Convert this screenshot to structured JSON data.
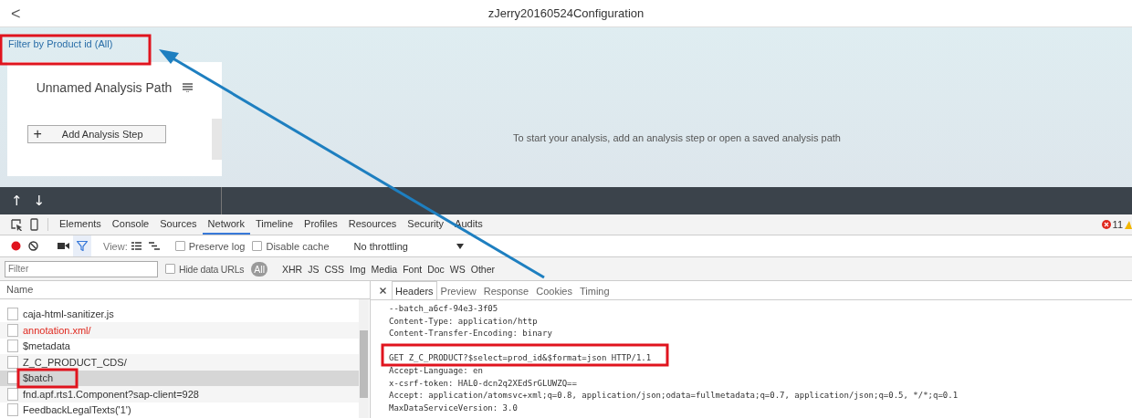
{
  "header": {
    "back": "<",
    "title": "zJerry20160524Configuration"
  },
  "filter_link": "Filter by Product id (All)",
  "analysis_path": {
    "title": "Unnamed Analysis Path",
    "add_button": {
      "icon": "+",
      "label": "Add Analysis Step"
    }
  },
  "empty_message": "To start your analysis, add an analysis step or open a saved analysis path",
  "nav_buttons": [
    "↑",
    "↓"
  ],
  "devtools": {
    "tabs": [
      {
        "label": "Elements",
        "selected": false
      },
      {
        "label": "Console",
        "selected": false
      },
      {
        "label": "Sources",
        "selected": false
      },
      {
        "label": "Network",
        "selected": true
      },
      {
        "label": "Timeline",
        "selected": false
      },
      {
        "label": "Profiles",
        "selected": false
      },
      {
        "label": "Resources",
        "selected": false
      },
      {
        "label": "Security",
        "selected": false
      },
      {
        "label": "Audits",
        "selected": false
      }
    ],
    "error_count": "11",
    "toolbar": {
      "recording": true,
      "filter_active": true,
      "view_label": "View:",
      "preserve_log": {
        "label": "Preserve log",
        "checked": false
      },
      "disable_cache": {
        "label": "Disable cache",
        "checked": false
      },
      "throttling": "No throttling"
    },
    "filter": {
      "placeholder": "Filter",
      "hide_data_urls": {
        "label": "Hide data URLs",
        "checked": false
      },
      "types": [
        {
          "label": "All",
          "selected": true
        },
        {
          "label": "XHR",
          "selected": false
        },
        {
          "label": "JS",
          "selected": false
        },
        {
          "label": "CSS",
          "selected": false
        },
        {
          "label": "Img",
          "selected": false
        },
        {
          "label": "Media",
          "selected": false
        },
        {
          "label": "Font",
          "selected": false
        },
        {
          "label": "Doc",
          "selected": false
        },
        {
          "label": "WS",
          "selected": false
        },
        {
          "label": "Other",
          "selected": false
        }
      ]
    },
    "requests": {
      "column": "Name",
      "rows": [
        {
          "name": "caja-html-sanitizer.js",
          "failed": false,
          "selected": false
        },
        {
          "name": "annotation.xml/",
          "failed": true,
          "selected": false
        },
        {
          "name": "$metadata",
          "failed": false,
          "selected": false
        },
        {
          "name": "Z_C_PRODUCT_CDS/",
          "failed": false,
          "selected": false
        },
        {
          "name": "$batch",
          "failed": false,
          "selected": true
        },
        {
          "name": "fnd.apf.rts1.Component?sap-client=928",
          "failed": false,
          "selected": false
        },
        {
          "name": "FeedbackLegalTexts('1')",
          "failed": false,
          "selected": false
        }
      ]
    },
    "detail_tabs": [
      {
        "label": "Headers",
        "selected": true
      },
      {
        "label": "Preview",
        "selected": false
      },
      {
        "label": "Response",
        "selected": false
      },
      {
        "label": "Cookies",
        "selected": false
      },
      {
        "label": "Timing",
        "selected": false
      }
    ],
    "detail_lines": [
      {
        "text": "--batch_a6cf-94e3-3f05",
        "gap_before": false
      },
      {
        "text": "Content-Type: application/http",
        "gap_before": false
      },
      {
        "text": "Content-Transfer-Encoding: binary",
        "gap_before": false
      },
      {
        "text": "GET Z_C_PRODUCT?$select=prod_id&$format=json HTTP/1.1",
        "gap_before": true
      },
      {
        "text": "Accept-Language: en",
        "gap_before": false
      },
      {
        "text": "x-csrf-token: HAL0-dcn2q2XEdSrGLUWZQ==",
        "gap_before": false
      },
      {
        "text": "Accept: application/atomsvc+xml;q=0.8, application/json;odata=fullmetadata;q=0.7, application/json;q=0.5, */*;q=0.1",
        "gap_before": false
      },
      {
        "text": "MaxDataServiceVersion: 3.0",
        "gap_before": false
      }
    ]
  }
}
